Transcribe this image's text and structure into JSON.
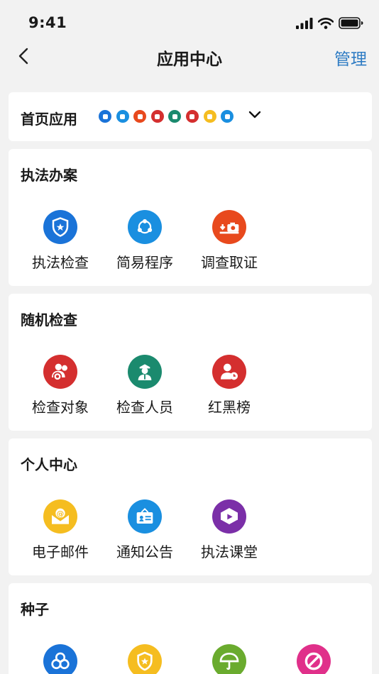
{
  "status": {
    "time": "9:41"
  },
  "nav": {
    "title": "应用中心",
    "manage_label": "管理"
  },
  "home_apps": {
    "label": "首页应用",
    "mini_icons": [
      {
        "name": "badge-shield-icon",
        "color": "#1a73d8"
      },
      {
        "name": "share-nodes-icon",
        "color": "#1a8fe0"
      },
      {
        "name": "camera-icon",
        "color": "#e8491d"
      },
      {
        "name": "people-icon",
        "color": "#d42f2f"
      },
      {
        "name": "officer-icon",
        "color": "#1b8a6e"
      },
      {
        "name": "person-clock-icon",
        "color": "#d42f2f"
      },
      {
        "name": "mail-icon",
        "color": "#f5bd20"
      },
      {
        "name": "notice-icon",
        "color": "#1a8fe0"
      }
    ]
  },
  "sections": [
    {
      "title": "执法办案",
      "apps": [
        {
          "label": "执法检查",
          "icon": "badge-shield-icon",
          "color": "#1a73d8"
        },
        {
          "label": "简易程序",
          "icon": "share-nodes-icon",
          "color": "#1a8fe0"
        },
        {
          "label": "调查取证",
          "icon": "camera-icon",
          "color": "#e8491d"
        }
      ]
    },
    {
      "title": "随机检查",
      "apps": [
        {
          "label": "检查对象",
          "icon": "people-icon",
          "color": "#d42f2f"
        },
        {
          "label": "检查人员",
          "icon": "officer-icon",
          "color": "#1b8a6e"
        },
        {
          "label": "红黑榜",
          "icon": "person-clock-icon",
          "color": "#d42f2f"
        }
      ]
    },
    {
      "title": "个人中心",
      "apps": [
        {
          "label": "电子邮件",
          "icon": "mail-icon",
          "color": "#f5bd20"
        },
        {
          "label": "通知公告",
          "icon": "notice-icon",
          "color": "#1a8fe0"
        },
        {
          "label": "执法课堂",
          "icon": "video-class-icon",
          "color": "#7b2fa8"
        }
      ]
    },
    {
      "title": "种子",
      "apps": [
        {
          "icon": "circles-icon",
          "color": "#1a73d8"
        },
        {
          "icon": "shield-star-icon",
          "color": "#f5bd20"
        },
        {
          "icon": "umbrella-icon",
          "color": "#6aab2e"
        },
        {
          "icon": "forbidden-icon",
          "color": "#e0308a"
        }
      ]
    }
  ]
}
